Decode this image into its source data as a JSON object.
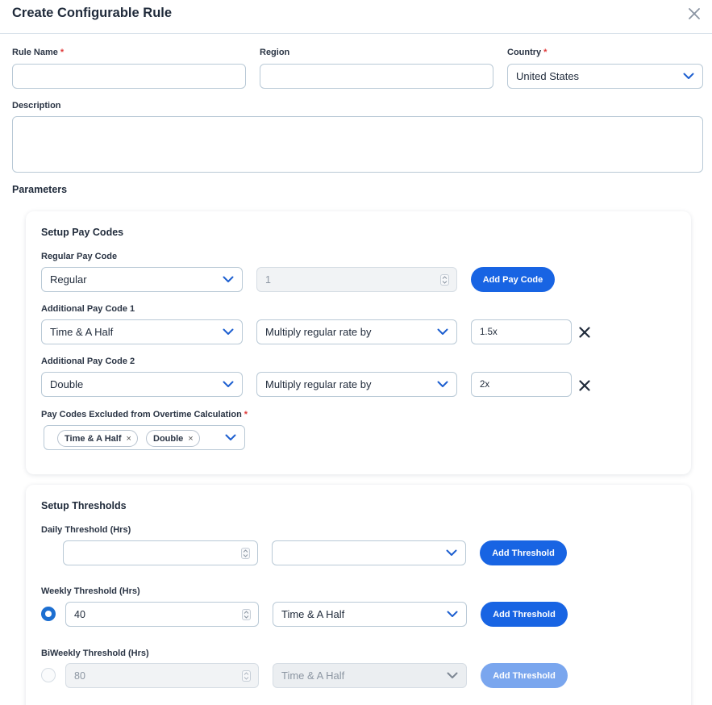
{
  "dialog": {
    "title": "Create Configurable Rule"
  },
  "form": {
    "rule_name": {
      "label": "Rule Name",
      "value": "",
      "placeholder": ""
    },
    "region": {
      "label": "Region",
      "value": "",
      "placeholder": ""
    },
    "country": {
      "label": "Country",
      "value": "United States"
    },
    "description": {
      "label": "Description",
      "value": ""
    }
  },
  "parameters": {
    "label": "Parameters"
  },
  "pay_codes": {
    "title": "Setup Pay Codes",
    "regular": {
      "label": "Regular Pay Code",
      "value": "Regular",
      "quantity": "1",
      "add_button": "Add Pay Code"
    },
    "additional": [
      {
        "label": "Additional Pay Code 1",
        "code": "Time & A Half",
        "method": "Multiply regular rate by",
        "factor": "1.5x"
      },
      {
        "label": "Additional Pay Code 2",
        "code": "Double",
        "method": "Multiply regular rate by",
        "factor": "2x"
      }
    ],
    "excluded": {
      "label": "Pay Codes Excluded from Overtime Calculation",
      "tags": [
        "Time & A Half",
        "Double"
      ],
      "remove_symbol": "×"
    }
  },
  "thresholds": {
    "title": "Setup Thresholds",
    "rows": [
      {
        "label": "Daily Threshold (Hrs)",
        "value": "",
        "code": "",
        "button": "Add Threshold",
        "selected": null
      },
      {
        "label": "Weekly Threshold (Hrs)",
        "value": "40",
        "code": "Time & A Half",
        "button": "Add Threshold",
        "selected": true
      },
      {
        "label": "BiWeekly Threshold (Hrs)",
        "value": "80",
        "code": "Time & A Half",
        "button": "Add Threshold",
        "selected": false
      }
    ]
  },
  "colors": {
    "primary": "#1864e3",
    "primary_disabled": "#7aa6ee",
    "required": "#e03a3a",
    "border": "#b9c9d6",
    "chevron": "#1d5fd0"
  },
  "icons": [
    "close-icon",
    "chevron-down-icon",
    "remove-icon",
    "stepper-icon",
    "radio-icon"
  ]
}
